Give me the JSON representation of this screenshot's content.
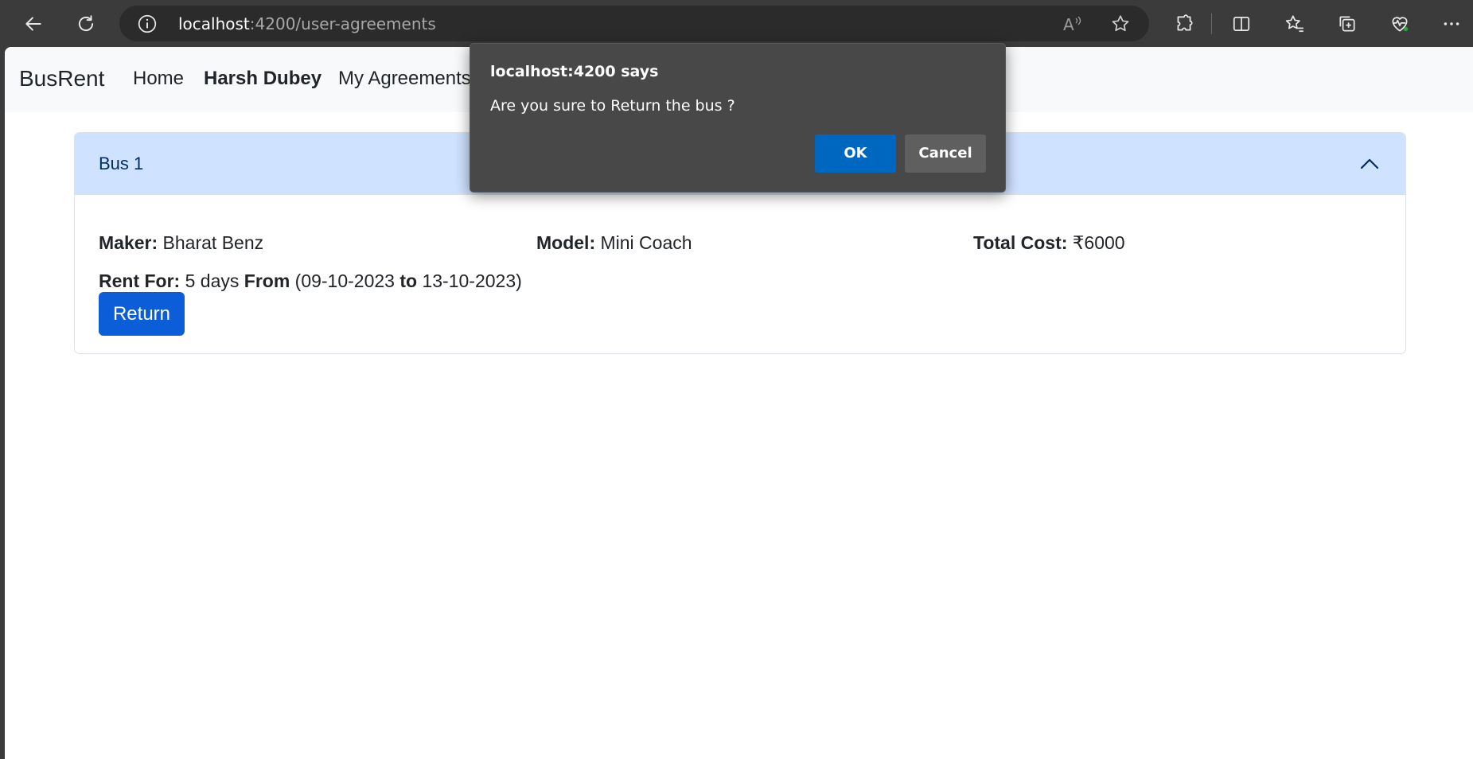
{
  "browser": {
    "url_host": "localhost",
    "url_rest": ":4200/user-agreements"
  },
  "navbar": {
    "brand": "BusRent",
    "links": [
      "Home",
      "Harsh Dubey",
      "My Agreements"
    ]
  },
  "agreement": {
    "title": "Bus 1",
    "maker_label": "Maker:",
    "maker_value": "Bharat Benz",
    "model_label": "Model:",
    "model_value": "Mini Coach",
    "cost_label": "Total Cost:",
    "cost_value": "₹6000",
    "rent_label": "Rent For:",
    "rent_days": "5 days",
    "from_label": "From",
    "date_open": "(09-10-2023",
    "to_label": "to",
    "date_close": "13-10-2023)",
    "return_label": "Return"
  },
  "dialog": {
    "title": "localhost:4200 says",
    "message": "Are you sure to Return the bus ?",
    "ok_label": "OK",
    "cancel_label": "Cancel"
  },
  "colors": {
    "accent": "#0b5ed7",
    "header_bg": "#cfe2ff",
    "dialog_ok": "#0067c0"
  },
  "icons": [
    "back-icon",
    "refresh-icon",
    "info-icon",
    "read-aloud-icon",
    "favorite-star-icon",
    "extensions-icon",
    "split-screen-icon",
    "favorites-icon",
    "collections-icon",
    "browser-essentials-icon",
    "more-icon",
    "chevron-up-icon"
  ]
}
